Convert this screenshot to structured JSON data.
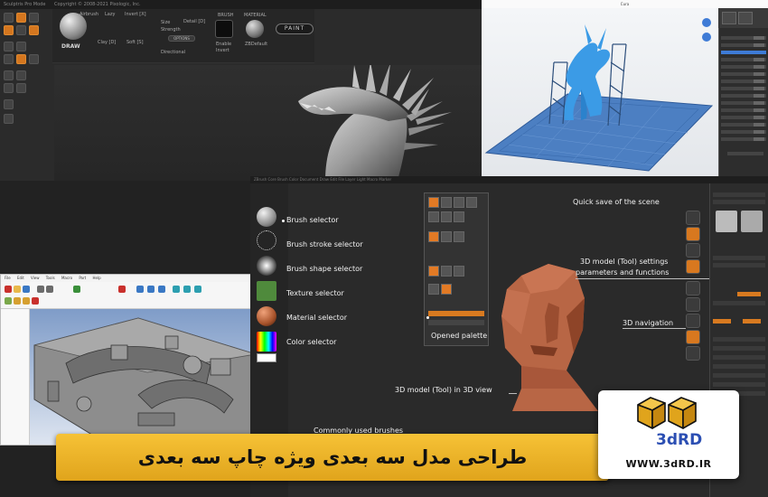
{
  "zbrush_top": {
    "title_items": [
      "Sculptris Pro Mode",
      "Copyright © 2008-2021 Pixologic, Inc."
    ],
    "draw_label": "DRAW",
    "airbrush_label": "Airbrush",
    "lazy_label": "Lazy",
    "invert_label": "Invert [X]",
    "size_label": "Size",
    "strength_label": "Strength",
    "options_label": "OPTIONS",
    "clay_label": "Clay [D]",
    "soft_label": "Soft [S]",
    "directional_label": "Directional",
    "detail_label": "Detail [D]",
    "brush_label": "BRUSH",
    "material_label": "MATERIAL",
    "enable_label": "Enable",
    "invert2_label": "Invert",
    "default_label": "ZBDefault",
    "paint_label": "PAINT"
  },
  "slicer": {
    "title": "Cura"
  },
  "zbrush_main": {
    "top_text": "ZBrush Core   Brush   Color   Document   Draw   Edit   File   Layer   Light   Macro   Marker",
    "annotations": {
      "brush_selector": "Brush selector",
      "stroke_selector": "Brush stroke selector",
      "shape_selector": "Brush shape selector",
      "texture_selector": "Texture selector",
      "material_selector": "Material selector",
      "color_selector": "Color selector",
      "quick_save": "Quick save of the scene",
      "tool_settings_line1": "3D model (Tool) settings",
      "tool_settings_line2": "parameters and functions",
      "navigation": "3D navigation",
      "opened_palette": "Opened palette",
      "model_in_view": "3D model (Tool) in 3D view",
      "common_brushes": "Commonly used brushes"
    }
  },
  "cad": {
    "menu_items": [
      "File",
      "Edit",
      "View",
      "Tools",
      "Macro",
      "Part",
      "Help"
    ]
  },
  "banner": {
    "text": "طراحی مدل سه بعدی ویژه چاپ سه بعدی"
  },
  "logo": {
    "name": "3dRD",
    "url": "WWW.3dRD.IR",
    "brand_color": "#2c4fb3",
    "gold_color": "#f0b52a"
  }
}
